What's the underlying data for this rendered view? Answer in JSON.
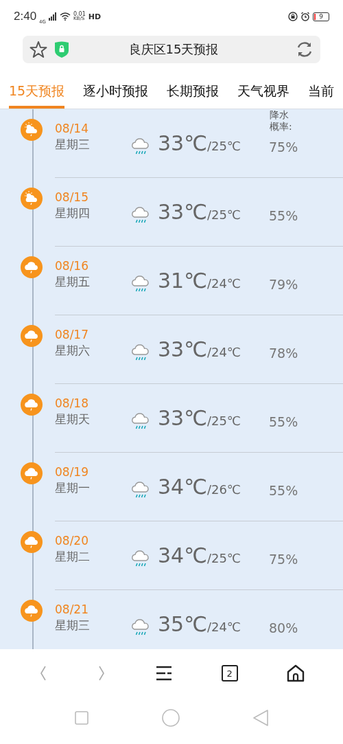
{
  "status_bar": {
    "time": "2:40",
    "network": "4G",
    "speed": "0.01",
    "speed_unit": "KB/S",
    "hd": "HD",
    "battery": "9"
  },
  "address_bar": {
    "title": "良庆区15天预报"
  },
  "tabs": [
    {
      "label": "15天预报",
      "selected": true
    },
    {
      "label": "逐小时预报",
      "selected": false
    },
    {
      "label": "长期预报",
      "selected": false
    },
    {
      "label": "天气视界",
      "selected": false
    },
    {
      "label": "当前",
      "selected": false
    }
  ],
  "precip_header": "降水概率:",
  "days": [
    {
      "date": "08/14",
      "weekday": "星期三",
      "kind": "partly-cloudy",
      "high": "33℃",
      "low": "/25℃",
      "precip": "75%"
    },
    {
      "date": "08/15",
      "weekday": "星期四",
      "kind": "partly-cloudy",
      "high": "33℃",
      "low": "/25℃",
      "precip": "55%"
    },
    {
      "date": "08/16",
      "weekday": "星期五",
      "kind": "rain",
      "high": "31℃",
      "low": "/24℃",
      "precip": "79%"
    },
    {
      "date": "08/17",
      "weekday": "星期六",
      "kind": "rain",
      "high": "33℃",
      "low": "/24℃",
      "precip": "78%"
    },
    {
      "date": "08/18",
      "weekday": "星期天",
      "kind": "rain",
      "high": "33℃",
      "low": "/25℃",
      "precip": "55%"
    },
    {
      "date": "08/19",
      "weekday": "星期一",
      "kind": "rain",
      "high": "34℃",
      "low": "/26℃",
      "precip": "55%"
    },
    {
      "date": "08/20",
      "weekday": "星期二",
      "kind": "rain",
      "high": "34℃",
      "low": "/25℃",
      "precip": "75%"
    },
    {
      "date": "08/21",
      "weekday": "星期三",
      "kind": "rain",
      "high": "35℃",
      "low": "/24℃",
      "precip": "80%"
    }
  ],
  "toolbar": {
    "tab_count": "2"
  }
}
